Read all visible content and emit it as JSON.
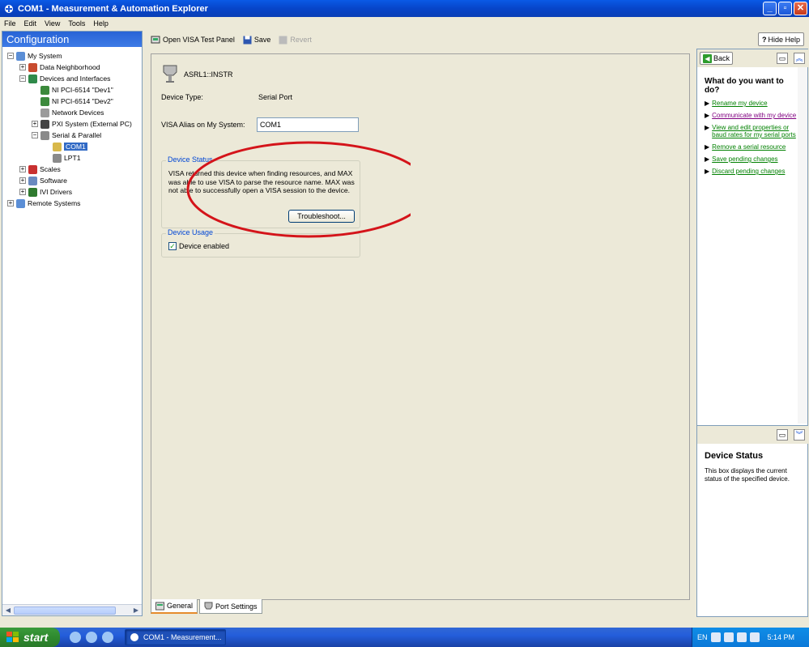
{
  "window": {
    "title": "COM1 - Measurement & Automation Explorer"
  },
  "menu": [
    "File",
    "Edit",
    "View",
    "Tools",
    "Help"
  ],
  "left_pane": {
    "header": "Configuration",
    "tree": [
      {
        "label": "My System",
        "depth": 0,
        "expander": "−"
      },
      {
        "label": "Data Neighborhood",
        "depth": 1,
        "expander": "+"
      },
      {
        "label": "Devices and Interfaces",
        "depth": 1,
        "expander": "−"
      },
      {
        "label": "NI PCI-6514 \"Dev1\"",
        "depth": 2,
        "expander": ""
      },
      {
        "label": "NI PCI-6514 \"Dev2\"",
        "depth": 2,
        "expander": ""
      },
      {
        "label": "Network Devices",
        "depth": 2,
        "expander": ""
      },
      {
        "label": "PXI System (External PC)",
        "depth": 2,
        "expander": "+"
      },
      {
        "label": "Serial & Parallel",
        "depth": 2,
        "expander": "−"
      },
      {
        "label": "COM1",
        "depth": 3,
        "expander": "",
        "selected": true
      },
      {
        "label": "LPT1",
        "depth": 3,
        "expander": ""
      },
      {
        "label": "Scales",
        "depth": 1,
        "expander": "+"
      },
      {
        "label": "Software",
        "depth": 1,
        "expander": "+"
      },
      {
        "label": "IVI Drivers",
        "depth": 1,
        "expander": "+"
      },
      {
        "label": "Remote Systems",
        "depth": 0,
        "expander": "+"
      }
    ]
  },
  "toolbar": {
    "open_visa": "Open VISA Test Panel",
    "save": "Save",
    "revert": "Revert",
    "hide_help": "Hide Help"
  },
  "device": {
    "resource_name": "ASRL1::INSTR",
    "type_label": "Device Type:",
    "type_value": "Serial Port",
    "alias_label": "VISA Alias on My System:",
    "alias_value": "COM1",
    "status_title": "Device Status",
    "status_text": "VISA returned this device when finding resources, and MAX was able to use VISA to parse the resource name.  MAX was not able to successfully open a VISA session to the device.",
    "troubleshoot": "Troubleshoot...",
    "usage_title": "Device Usage",
    "enabled_label": "Device enabled",
    "enabled": true
  },
  "tabs": [
    "General",
    "Port Settings"
  ],
  "help": {
    "back": "Back",
    "heading": "What do you want to do?",
    "links": [
      "Rename my device",
      "Communicate with my device",
      "View and edit properties or baud rates for my serial ports",
      "Remove a serial resource",
      "Save pending changes",
      "Discard pending changes"
    ],
    "bottom_title": "Device Status",
    "bottom_text": "This box displays the current status of the specified device."
  },
  "taskbar": {
    "start": "start",
    "app": "COM1 - Measurement...",
    "lang": "EN",
    "time": "5:14 PM"
  },
  "colors": {
    "annotation_circle": "#d4141a",
    "selection": "#316ac5",
    "link": "#008000"
  }
}
